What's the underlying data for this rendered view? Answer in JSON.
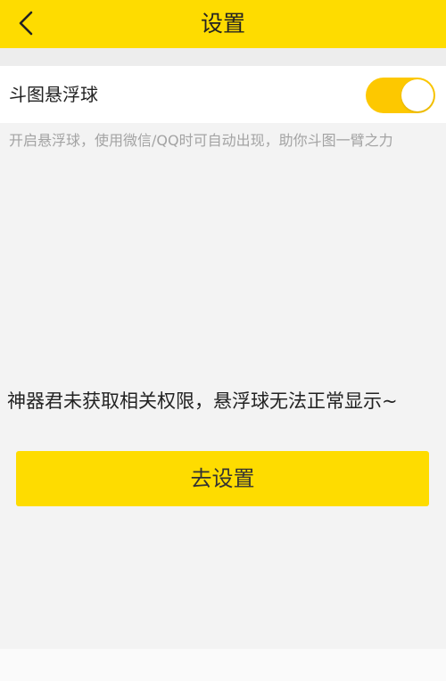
{
  "header": {
    "back_icon": "chevron-left-icon",
    "title": "设置"
  },
  "setting": {
    "label": "斗图悬浮球",
    "toggle_on": true,
    "description": "开启悬浮球，使用微信/QQ时可自动出现，助你斗图一臂之力"
  },
  "permission": {
    "message": "神器君未获取相关权限，悬浮球无法正常显示~",
    "button_label": "去设置"
  },
  "colors": {
    "accent": "#fedc00",
    "toggle": "#fdc800",
    "background": "#f3f3f3"
  }
}
